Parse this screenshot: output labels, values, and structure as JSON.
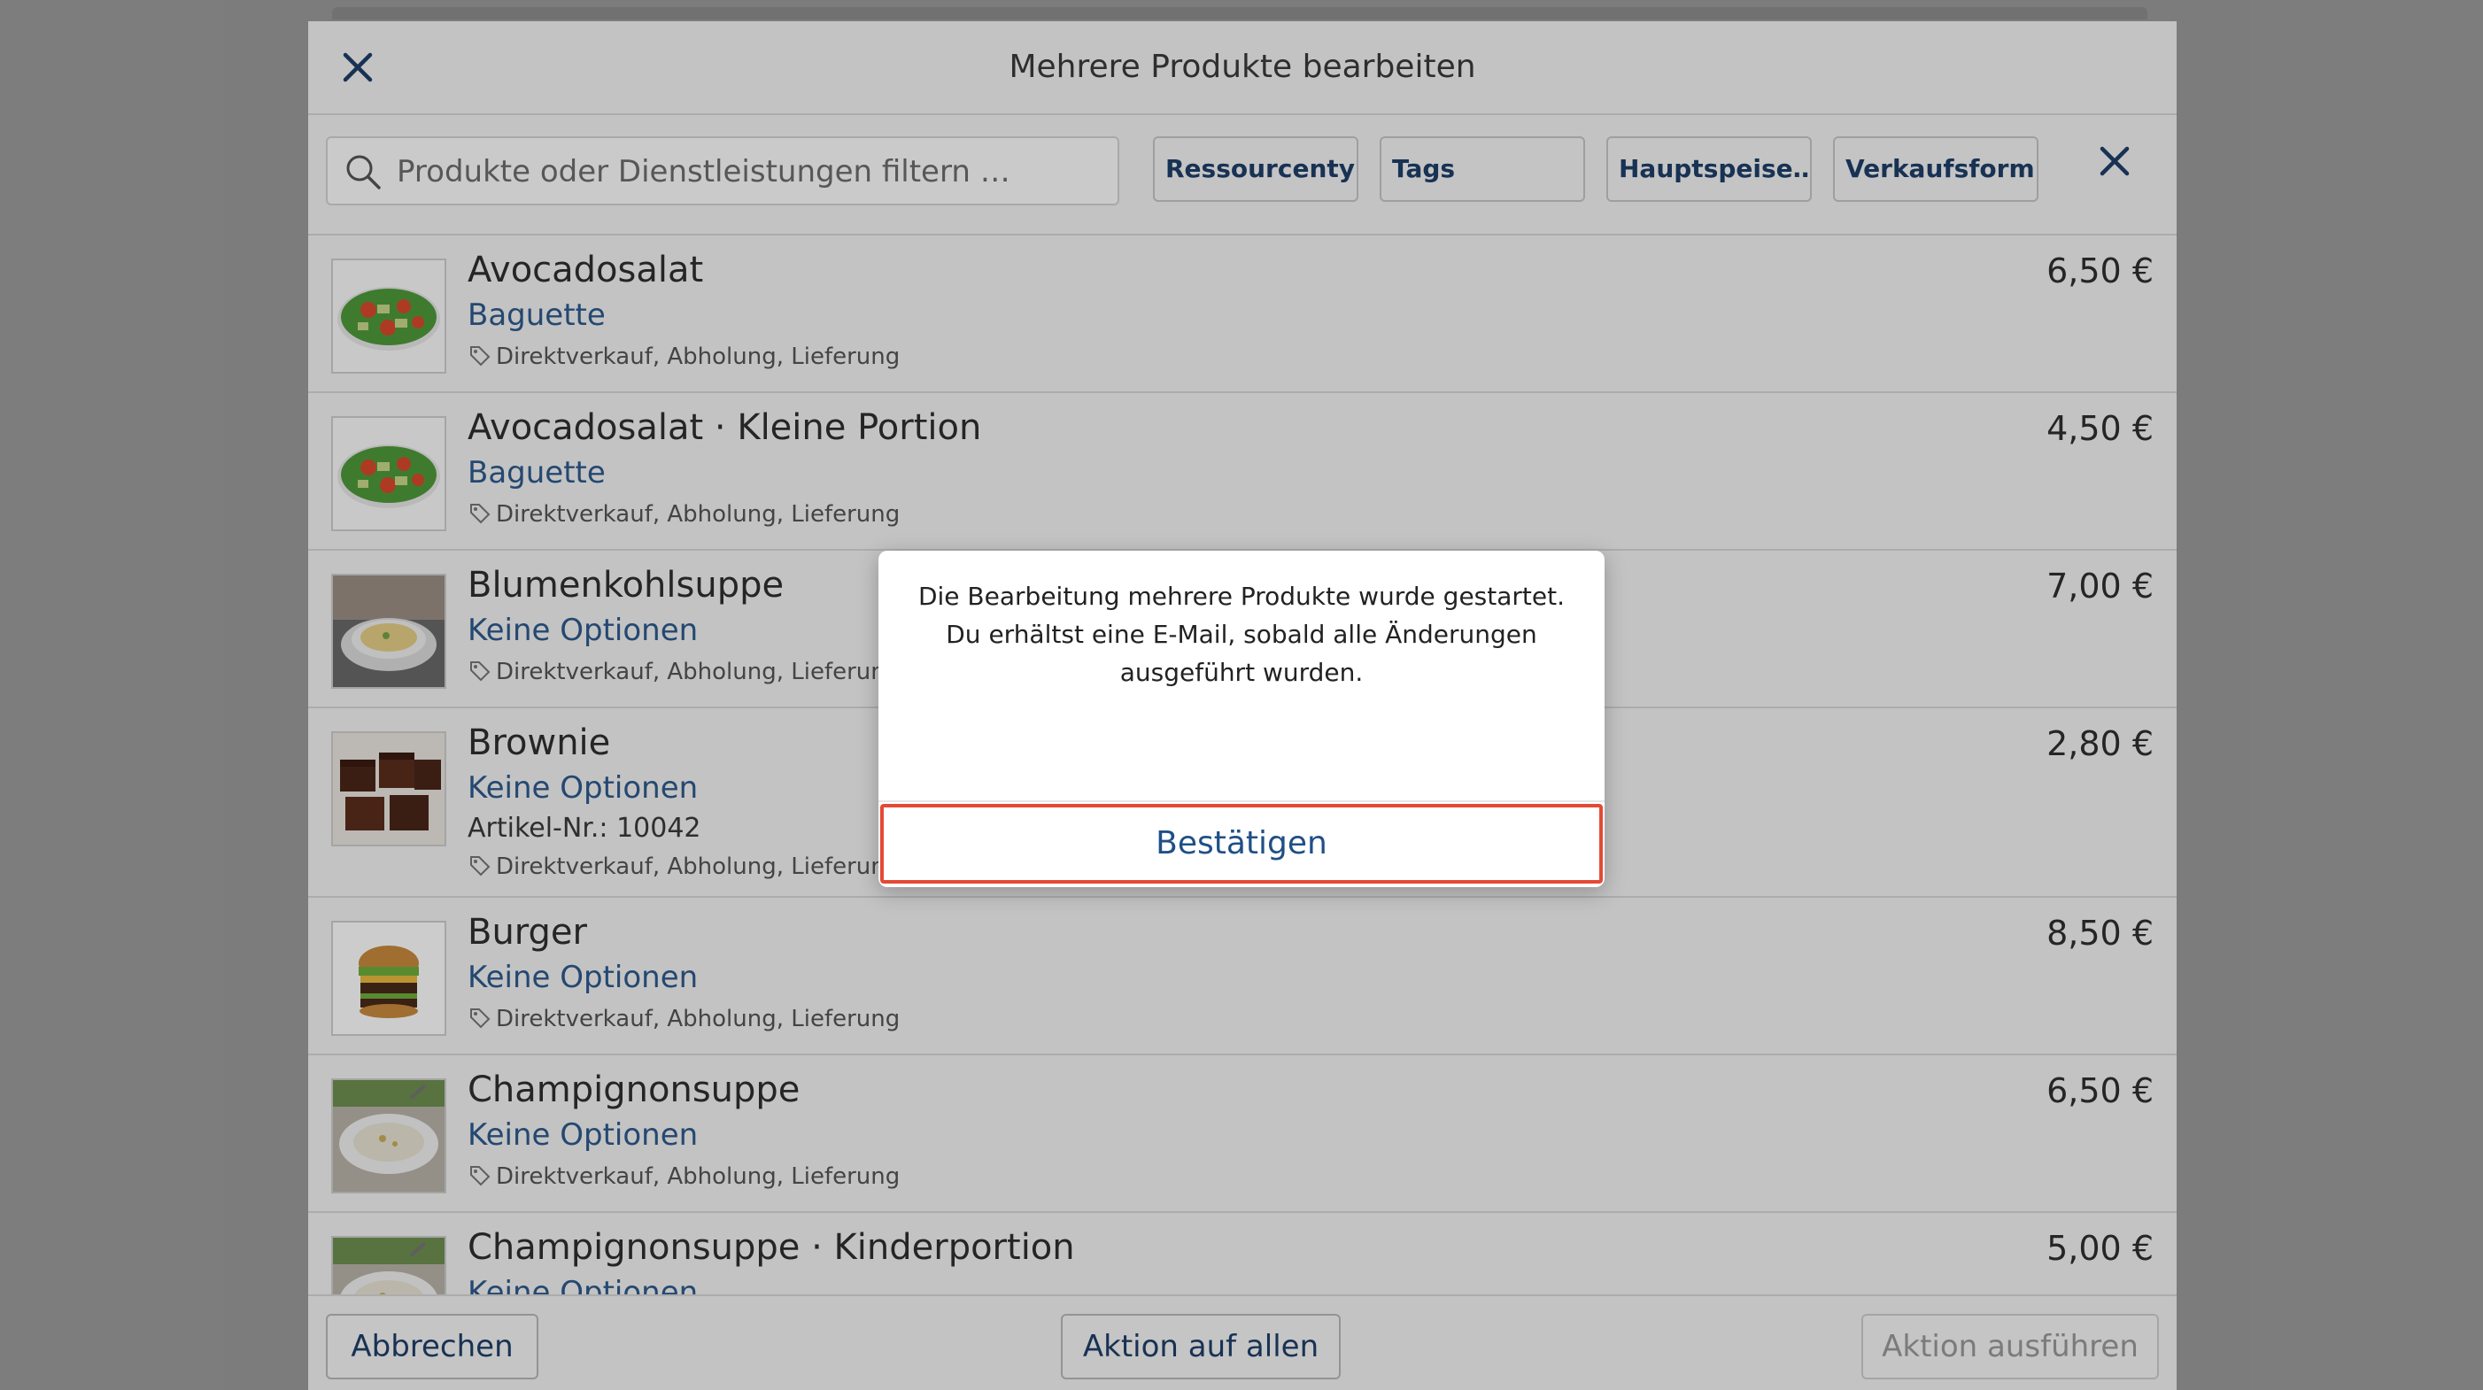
{
  "header": {
    "title": "Mehrere Produkte bearbeiten"
  },
  "filter": {
    "search_placeholder": "Produkte oder Dienstleistungen filtern …",
    "chips": [
      "Ressourcentyp",
      "Tags",
      "Hauptspeise…",
      "Verkaufsform"
    ]
  },
  "products": [
    {
      "name": "Avocadosalat",
      "variant": "Baguette",
      "channels": "Direktverkauf, Abholung, Lieferung",
      "price": "6,50 €",
      "image": "salad"
    },
    {
      "name": "Avocadosalat · Kleine Portion",
      "variant": "Baguette",
      "channels": "Direktverkauf, Abholung, Lieferung",
      "price": "4,50 €",
      "image": "salad"
    },
    {
      "name": "Blumenkohlsuppe",
      "variant": "Keine Optionen",
      "channels": "Direktverkauf, Abholung, Lieferung",
      "price": "7,00 €",
      "image": "soup-yellow"
    },
    {
      "name": "Brownie",
      "variant": "Keine Optionen",
      "sku": "Artikel-Nr.: 10042",
      "channels": "Direktverkauf, Abholung, Lieferung",
      "price": "2,80 €",
      "image": "brownie"
    },
    {
      "name": "Burger",
      "variant": "Keine Optionen",
      "channels": "Direktverkauf, Abholung, Lieferung",
      "price": "8,50 €",
      "image": "burger"
    },
    {
      "name": "Champignonsuppe",
      "variant": "Keine Optionen",
      "channels": "Direktverkauf, Abholung, Lieferung",
      "price": "6,50 €",
      "image": "soup-white"
    },
    {
      "name": "Champignonsuppe · Kinderportion",
      "variant": "Keine Optionen",
      "channels": "",
      "price": "5,00 €",
      "image": "soup-white"
    }
  ],
  "footer": {
    "cancel_label": "Abbrechen",
    "all_label": "Aktion auf allen",
    "run_label": "Aktion ausführen"
  },
  "dialog": {
    "message": "Die Bearbeitung mehrere Produkte wurde gestartet. Du erhältst eine E-Mail, sobald alle Änderungen ausgeführt wurden.",
    "confirm_label": "Bestätigen"
  },
  "colors": {
    "accent": "#1f3f6a",
    "variant": "#2d5a8e",
    "highlight": "#e44a34"
  }
}
